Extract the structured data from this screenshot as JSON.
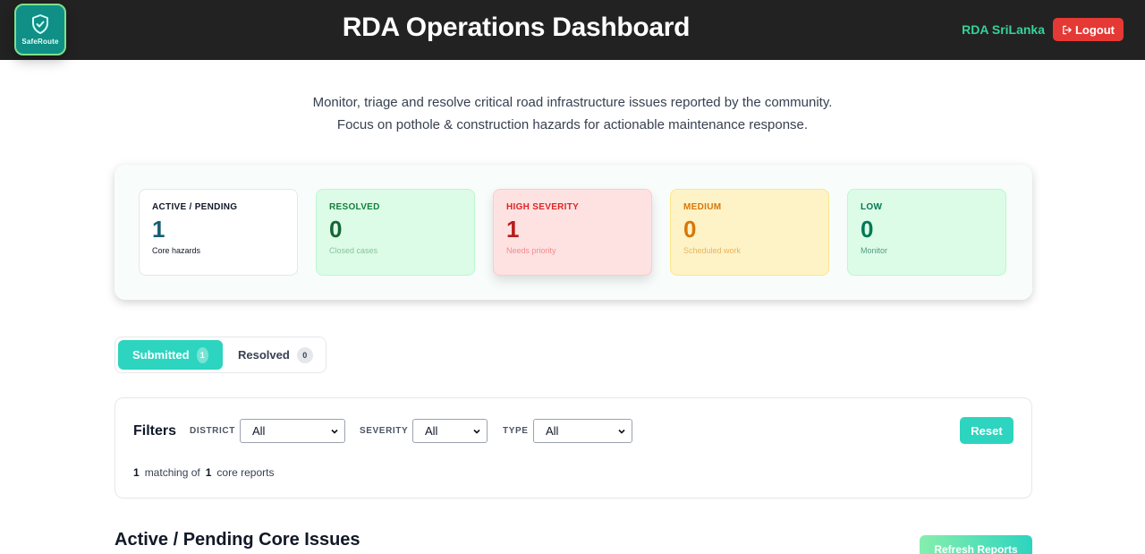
{
  "header": {
    "logo_text": "SafeRoute",
    "title": "RDA Operations Dashboard",
    "user": "RDA SriLanka",
    "logout_label": "Logout",
    "logo_icon": "shield-check-icon",
    "logout_icon": "logout-icon"
  },
  "intro": {
    "line1": "Monitor, triage and resolve critical road infrastructure issues reported by the community.",
    "line2": "Focus on pothole & construction hazards for actionable maintenance response."
  },
  "stats": {
    "active": {
      "label": "ACTIVE / PENDING",
      "value": "1",
      "sub": "Core hazards"
    },
    "resolved": {
      "label": "RESOLVED",
      "value": "0",
      "sub": "Closed cases"
    },
    "high": {
      "label": "HIGH SEVERITY",
      "value": "1",
      "sub": "Needs priority"
    },
    "medium": {
      "label": "MEDIUM",
      "value": "0",
      "sub": "Scheduled work"
    },
    "low": {
      "label": "LOW",
      "value": "0",
      "sub": "Monitor"
    }
  },
  "tabs": [
    {
      "label": "Submitted",
      "count": "1"
    },
    {
      "label": "Resolved",
      "count": "0"
    }
  ],
  "filters": {
    "title": "Filters",
    "district_label": "DISTRICT",
    "district_value": "All",
    "severity_label": "SEVERITY",
    "severity_value": "All",
    "type_label": "TYPE",
    "type_value": "All",
    "reset_label": "Reset",
    "match_count": "1",
    "match_text": "matching of",
    "total_count": "1",
    "total_text": "core reports"
  },
  "section": {
    "title": "Active / Pending Core Issues",
    "refresh_label": "Refresh Reports"
  },
  "colors": {
    "header_bg": "#222222",
    "accent_teal": "#2dd4bf",
    "logout_red": "#e53935",
    "user_green": "#34d399"
  }
}
